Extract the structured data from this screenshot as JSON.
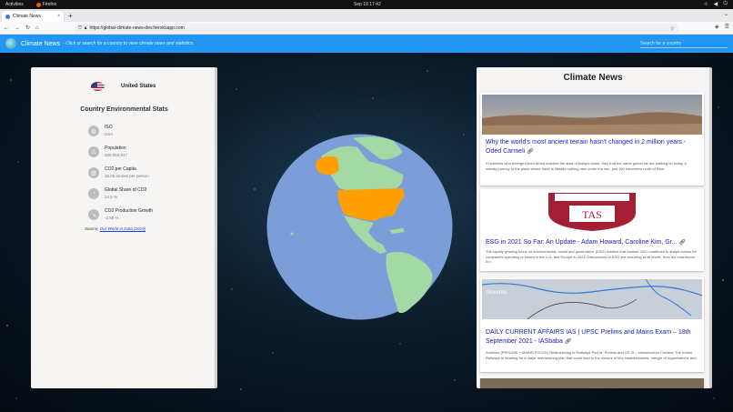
{
  "system": {
    "activities": "Activities",
    "app_name": "Firefox",
    "clock": "Sep 19  17:42"
  },
  "browser": {
    "tab_title": "Climate News",
    "tab_close": "×",
    "new_tab": "+",
    "url": "https://global-climate-news-dev.herokuapp.com"
  },
  "app": {
    "title": "Climate News",
    "subtitle": "- Click or search for a country to view climate news and statistics.",
    "search_placeholder": "Search for a country"
  },
  "stats_panel": {
    "country_name": "United States",
    "title": "Country Environmental Stats",
    "items": [
      {
        "label": "ISO",
        "value": "USA",
        "icon": "globe-icon"
      },
      {
        "label": "Population",
        "value": "329,064,917",
        "icon": "person-icon"
      },
      {
        "label": "CO2 per Capita",
        "value": "16.06 tonnes per person",
        "icon": "factory-icon"
      },
      {
        "label": "Global Share of CO2",
        "value": "14.5 %",
        "icon": "pie-chart-icon"
      },
      {
        "label": "CO2 Production Growth",
        "value": "-2.58 %",
        "icon": "trend-icon"
      }
    ],
    "source_prefix": "Source: ",
    "source_link": "Our World in Data (2019)"
  },
  "news_panel": {
    "title": "Climate News",
    "articles": [
      {
        "title": "Why the world's most ancient terrain hasn't changed in 2 million years - Oded Carmeli",
        "snippet": "If hominids who emerged from Africa reached the area of today's Israel, they trod the same gravel we are walking on today. A sweaty journey to the place where there is literally nothing new under the sun, just 100 kilometers north of Eilat."
      },
      {
        "title": "ESG in 2021 So Far: An Update - Adam Howard, Caroline Kim, Gr...",
        "snippet": "The rapidly growing focus on environmental, social and governance (ESG) matters that marked 2020 continues to shape events for companies operating or based in the U.S. and Europe in 2021. Discussions of ESG are occurring at all levels, from the boardroom to t..."
      },
      {
        "title": "DAILY CURRENT AFFAIRS IAS | UPSC Prelims and Mains Exam – 18th September 2021 - IASbaba",
        "snippet": "Archives (PRELIMS + MAINS FOCUS) Restructuring of Railways Part of: Prelims and GS III – Infrastructure Context: The Indian Railways is heading for a major restructuring plan that could lead to the closure of key establishments, merger of organisations and ..."
      }
    ],
    "map_label": "Slovenia",
    "seal_text": "TAS"
  },
  "colors": {
    "appbar": "#2196f3",
    "highlight_country": "#ffa000",
    "land": "#a3d9a5",
    "ocean": "#7b9ed8",
    "link": "#1a23c9"
  }
}
